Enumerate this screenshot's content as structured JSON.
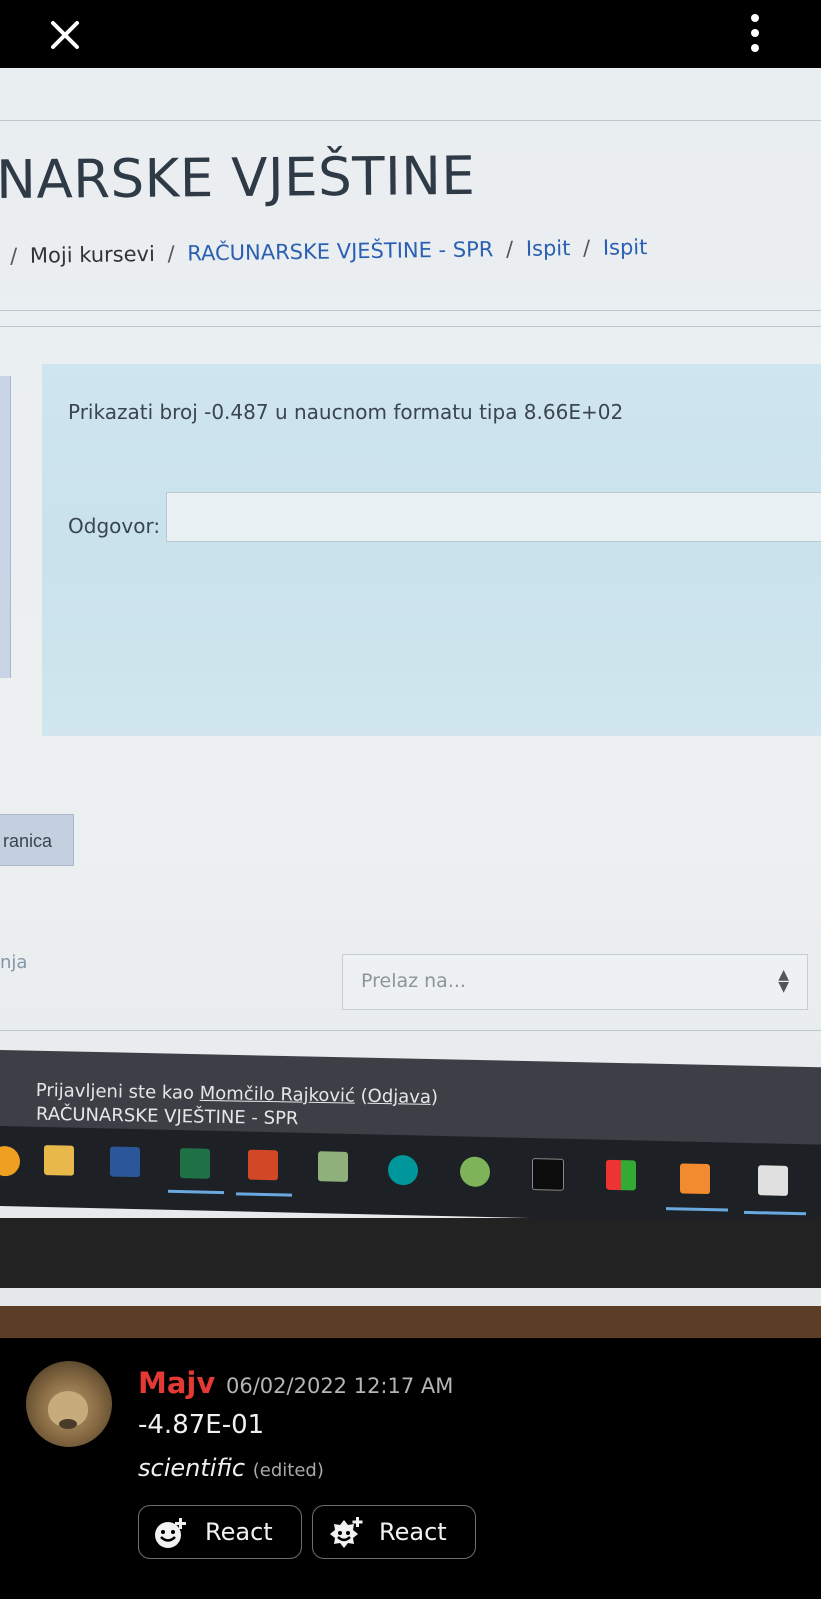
{
  "course_title": "NARSKE VJEŠTINE",
  "breadcrumb": {
    "sep1": "/",
    "moji_kursevi": "Moji kursevi",
    "sep2": "/",
    "course": "RAČUNARSKE VJEŠTINE - SPR",
    "sep3": "/",
    "ispit1": "Ispit",
    "sep4": "/",
    "ispit2": "Ispit"
  },
  "question": {
    "text": "Prikazati broj -0.487 u naucnom formatu tipa 8.66E+02",
    "answer_label": "Odgovor:",
    "answer_value": ""
  },
  "page_button": "ranica",
  "cut_text": "nja",
  "jump_select": {
    "placeholder": "Prelaz na..."
  },
  "footer": {
    "logged_in_prefix": "Prijavljeni ste kao ",
    "user_name": "Momčilo Rajković",
    "logout_open": " (",
    "logout": "Odjava",
    "logout_close": ")",
    "course": "RAČUNARSKE VJEŠTINE - SPR"
  },
  "message": {
    "username": "Majv",
    "timestamp": "06/02/2022 12:17 AM",
    "line1": "-4.87E-01",
    "line2": "scientific",
    "edited": "(edited)",
    "react_label_1": "React",
    "react_label_2": "React"
  },
  "colors": {
    "username": "#e53935",
    "link": "#2b5fb2",
    "question_bg": "#cfe5ef"
  },
  "taskbar_icons": [
    "folder-icon",
    "word-icon",
    "excel-icon",
    "powerpoint-icon",
    "notepad-icon",
    "arduino-icon",
    "android-icon",
    "terminal-icon",
    "color-app-icon",
    "xampp-icon",
    "calculator-icon"
  ]
}
